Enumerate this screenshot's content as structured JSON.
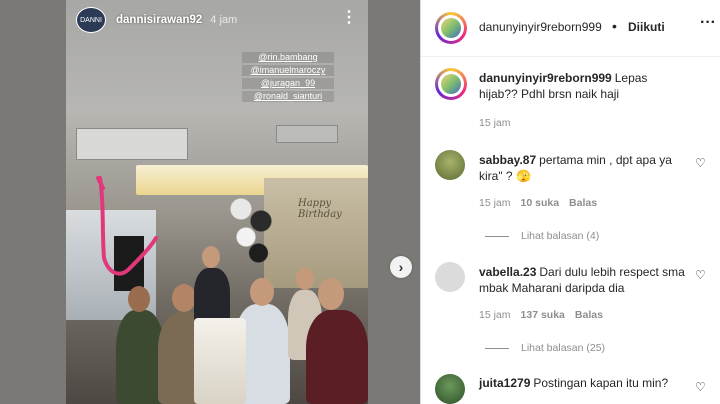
{
  "story": {
    "username": "dannisirawan92",
    "time": "4 jam",
    "more": "⋮",
    "avatar_text": "DANNI",
    "mentions": [
      "@rin.bambang",
      "@imanuelmaroczy",
      "@juragan_99",
      "@ronald_sianturi"
    ],
    "backdrop_text": "Happy Birthday",
    "next": "›"
  },
  "post": {
    "username": "danunyinyir9reborn999",
    "separator": "•",
    "follow_label": "Diikuti",
    "more": "···"
  },
  "caption": {
    "username": "danunyinyir9reborn999",
    "text": "Lepas hijab?? Pdhl brsn naik haji",
    "time": "15 jam"
  },
  "comments": [
    {
      "username": "sabbay.87",
      "text": "pertama min , dpt apa ya kira\" ? 🫣",
      "time": "15 jam",
      "likes": "10 suka",
      "reply": "Balas",
      "view_replies": "Lihat balasan (4)",
      "avatar_color": "#7a8f4a"
    },
    {
      "username": "vabella.23",
      "text": "Dari dulu lebih respect sma mbak Maharani daripda dia",
      "time": "15 jam",
      "likes": "137 suka",
      "reply": "Balas",
      "view_replies": "Lihat balasan (25)",
      "avatar_color": "#dbdbdb"
    },
    {
      "username": "juita1279",
      "text": "Postingan kapan itu min?",
      "avatar_color": "#3f6b3a"
    }
  ],
  "icons": {
    "heart": "heart-icon",
    "more": "more-icon",
    "next": "chevron-right-icon"
  }
}
